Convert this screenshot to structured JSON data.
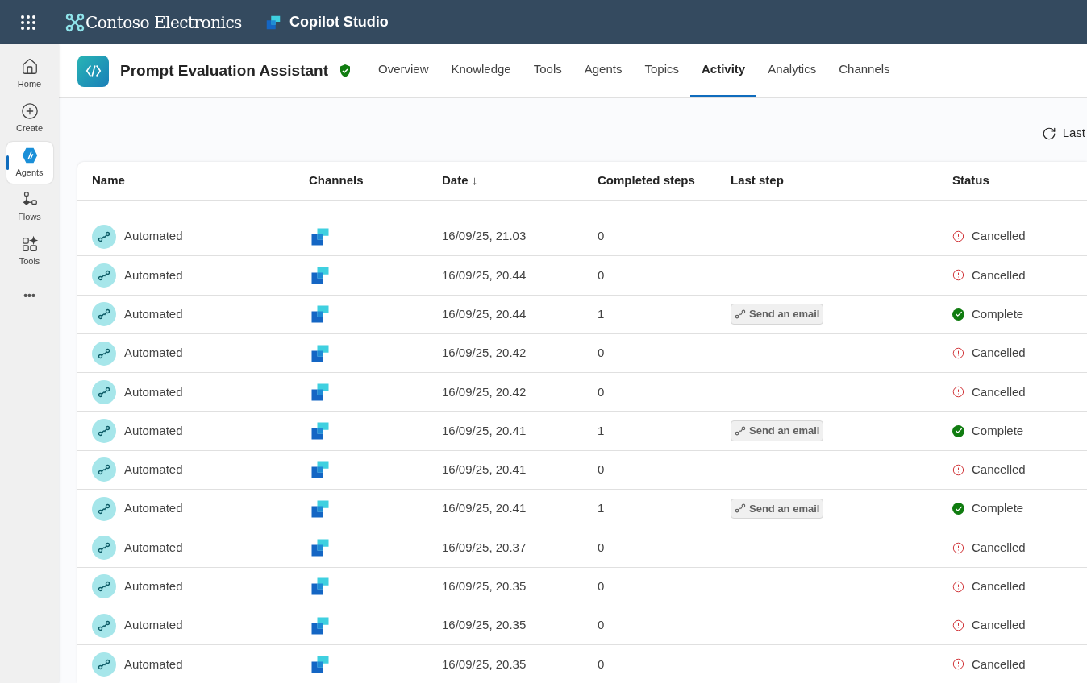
{
  "topbar": {
    "org": "Contoso Electronics",
    "product": "Copilot Studio"
  },
  "nav": [
    {
      "label": "Home",
      "kind": "home",
      "selected": false
    },
    {
      "label": "Create",
      "kind": "create",
      "selected": false
    },
    {
      "label": "Agents",
      "kind": "agents",
      "selected": true
    },
    {
      "label": "Flows",
      "kind": "flows",
      "selected": false
    },
    {
      "label": "Tools",
      "kind": "tools",
      "selected": false
    },
    {
      "label": "•••",
      "kind": "more",
      "selected": false
    }
  ],
  "agent": {
    "title": "Prompt Evaluation Assistant"
  },
  "tabs": [
    {
      "label": "Overview",
      "selected": false
    },
    {
      "label": "Knowledge",
      "selected": false
    },
    {
      "label": "Tools",
      "selected": false
    },
    {
      "label": "Agents",
      "selected": false
    },
    {
      "label": "Topics",
      "selected": false
    },
    {
      "label": "Activity",
      "selected": true
    },
    {
      "label": "Analytics",
      "selected": false
    },
    {
      "label": "Channels",
      "selected": false
    }
  ],
  "refresh": {
    "label": "Last"
  },
  "table": {
    "columns": [
      "Name",
      "Channels",
      "Date ↓",
      "Completed steps",
      "Last step",
      "Status"
    ],
    "rows": [
      {
        "name": "Automated",
        "date": "16/09/25, 21.03",
        "steps": "0",
        "status": "Cancelled",
        "kind": "cancelled"
      },
      {
        "name": "Automated",
        "date": "16/09/25, 20.44",
        "steps": "0",
        "status": "Cancelled",
        "kind": "cancelled"
      },
      {
        "name": "Automated",
        "date": "16/09/25, 20.44",
        "steps": "1",
        "last_step": "Send an email",
        "status": "Complete",
        "kind": "complete"
      },
      {
        "name": "Automated",
        "date": "16/09/25, 20.42",
        "steps": "0",
        "status": "Cancelled",
        "kind": "cancelled"
      },
      {
        "name": "Automated",
        "date": "16/09/25, 20.42",
        "steps": "0",
        "status": "Cancelled",
        "kind": "cancelled"
      },
      {
        "name": "Automated",
        "date": "16/09/25, 20.41",
        "steps": "1",
        "last_step": "Send an email",
        "status": "Complete",
        "kind": "complete"
      },
      {
        "name": "Automated",
        "date": "16/09/25, 20.41",
        "steps": "0",
        "status": "Cancelled",
        "kind": "cancelled"
      },
      {
        "name": "Automated",
        "date": "16/09/25, 20.41",
        "steps": "1",
        "last_step": "Send an email",
        "status": "Complete",
        "kind": "complete"
      },
      {
        "name": "Automated",
        "date": "16/09/25, 20.37",
        "steps": "0",
        "status": "Cancelled",
        "kind": "cancelled"
      },
      {
        "name": "Automated",
        "date": "16/09/25, 20.35",
        "steps": "0",
        "status": "Cancelled",
        "kind": "cancelled"
      },
      {
        "name": "Automated",
        "date": "16/09/25, 20.35",
        "steps": "0",
        "status": "Cancelled",
        "kind": "cancelled"
      },
      {
        "name": "Automated",
        "date": "16/09/25, 20.35",
        "steps": "0",
        "status": "Cancelled",
        "kind": "cancelled"
      }
    ]
  }
}
